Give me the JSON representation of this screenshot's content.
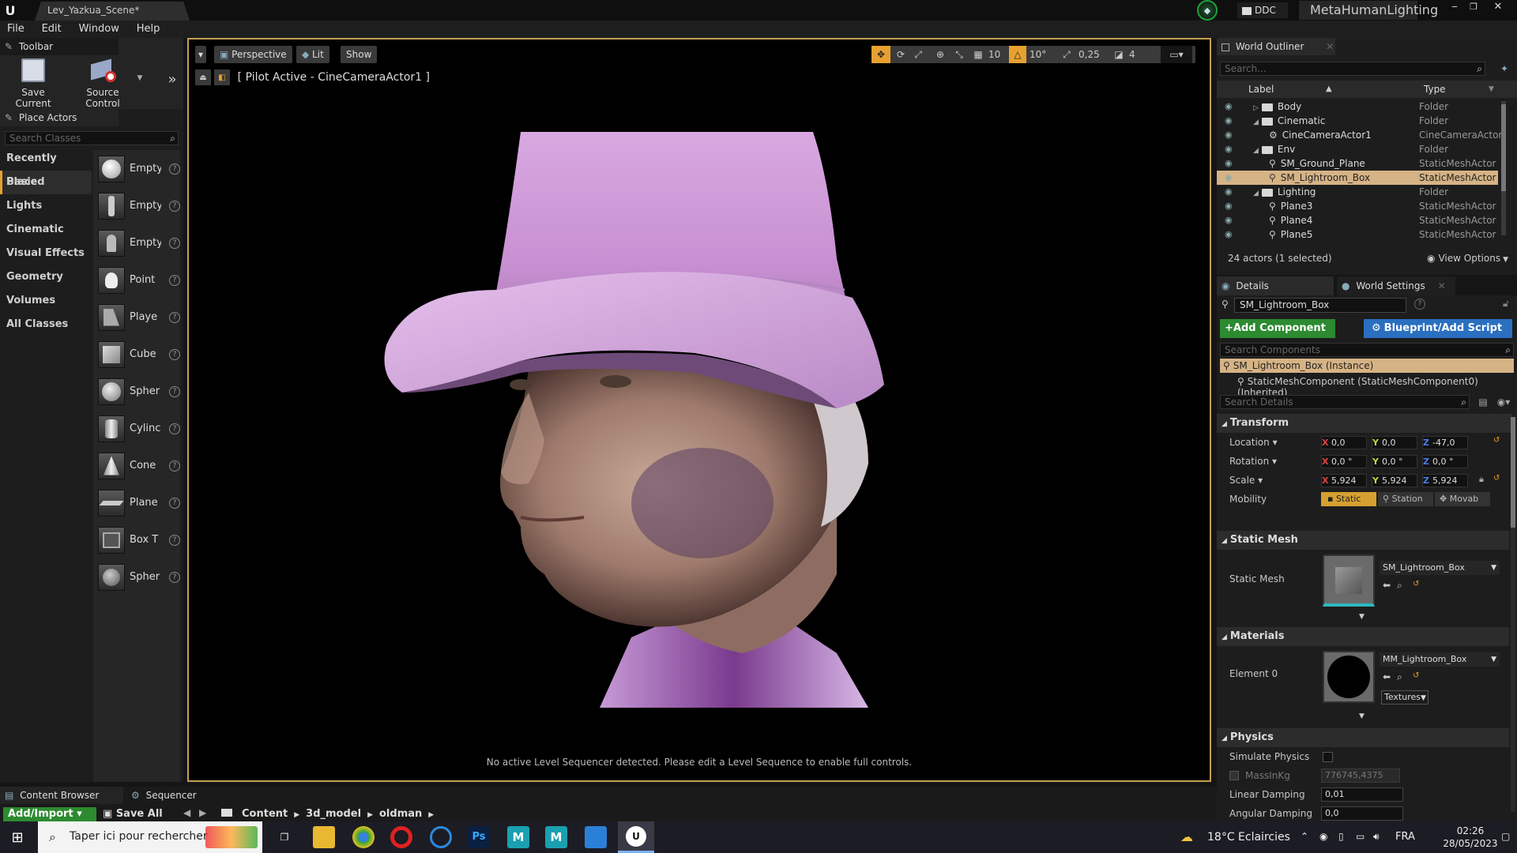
{
  "window": {
    "tab_title": "Lev_Yazkua_Scene*",
    "ddc_label": "DDC",
    "project_name": "MetaHumanLighting"
  },
  "menu": [
    "File",
    "Edit",
    "Window",
    "Help"
  ],
  "toolbar": {
    "tab_label": "Toolbar",
    "save_current": "Save Current",
    "source_control": "Source Control"
  },
  "place_actors": {
    "tab_label": "Place Actors",
    "search_placeholder": "Search Classes",
    "categories": [
      "Recently Placed",
      "Basic",
      "Lights",
      "Cinematic",
      "Visual Effects",
      "Geometry",
      "Volumes",
      "All Classes"
    ],
    "selected_category": "Basic",
    "items": [
      "Empty",
      "Empty",
      "Empty",
      "Point",
      "Playe",
      "Cube",
      "Spher",
      "Cylinc",
      "Cone",
      "Plane",
      "Box T",
      "Spher"
    ]
  },
  "viewport": {
    "perspective": "Perspective",
    "lit": "Lit",
    "show": "Show",
    "pilot_label": "[ Pilot Active - CineCameraActor1 ]",
    "grid_snap": "10",
    "rot_snap": "10°",
    "scale_snap": "0,25",
    "camera_speed": "4",
    "sequencer_message": "No active Level Sequencer detected. Please edit a Level Sequence to enable full controls."
  },
  "outliner": {
    "tab_label": "World Outliner",
    "search_placeholder": "Search...",
    "col_label": "Label",
    "col_type": "Type",
    "rows": [
      {
        "name": "Body",
        "type": "Folder"
      },
      {
        "name": "Cinematic",
        "type": "Folder"
      },
      {
        "name": "CineCameraActor1",
        "type": "CineCameraActor"
      },
      {
        "name": "Env",
        "type": "Folder"
      },
      {
        "name": "SM_Ground_Plane",
        "type": "StaticMeshActor"
      },
      {
        "name": "SM_Lightroom_Box",
        "type": "StaticMeshActor"
      },
      {
        "name": "Lighting",
        "type": "Folder"
      },
      {
        "name": "Plane3",
        "type": "StaticMeshActor"
      },
      {
        "name": "Plane4",
        "type": "StaticMeshActor"
      },
      {
        "name": "Plane5",
        "type": "StaticMeshActor"
      }
    ],
    "selected_row": "SM_Lightroom_Box",
    "actor_count": "24 actors (1 selected)",
    "view_options": "View Options"
  },
  "details": {
    "tab_label": "Details",
    "world_settings_tab": "World Settings",
    "actor_name": "SM_Lightroom_Box",
    "add_component": "+Add Component",
    "blueprint_script": "Blueprint/Add Script",
    "search_components": "Search Components",
    "instance_label": "SM_Lightroom_Box (Instance)",
    "component_label": "StaticMeshComponent (StaticMeshComponent0) (Inherited)",
    "search_details": "Search Details",
    "transform": {
      "title": "Transform",
      "location_label": "Location",
      "rotation_label": "Rotation",
      "scale_label": "Scale",
      "mobility_label": "Mobility",
      "location": [
        "0,0",
        "0,0",
        "-47,0"
      ],
      "rotation": [
        "0,0 °",
        "0,0 °",
        "0,0 °"
      ],
      "scale": [
        "5,924",
        "5,924",
        "5,924"
      ],
      "mobility": [
        "Static",
        "Station",
        "Movab"
      ]
    },
    "static_mesh": {
      "title": "Static Mesh",
      "label": "Static Mesh",
      "value": "SM_Lightroom_Box"
    },
    "materials": {
      "title": "Materials",
      "element_label": "Element 0",
      "value": "MM_Lightroom_Box",
      "textures": "Textures"
    },
    "physics": {
      "title": "Physics",
      "simulate": "Simulate Physics",
      "mass_label": "MassInKg",
      "mass_value": "776745,4375",
      "linear_damping_label": "Linear Damping",
      "linear_damping": "0,01",
      "angular_damping_label": "Angular Damping",
      "angular_damping": "0,0"
    }
  },
  "bottom": {
    "content_browser": "Content Browser",
    "sequencer": "Sequencer",
    "add_import": "Add/Import",
    "save_all": "Save All",
    "path": [
      "Content",
      "3d_model",
      "oldman"
    ]
  },
  "taskbar": {
    "search_placeholder": "Taper ici pour rechercher",
    "weather": "18°C Eclaircies",
    "lang": "FRA",
    "time": "02:26",
    "date": "28/05/2023"
  }
}
